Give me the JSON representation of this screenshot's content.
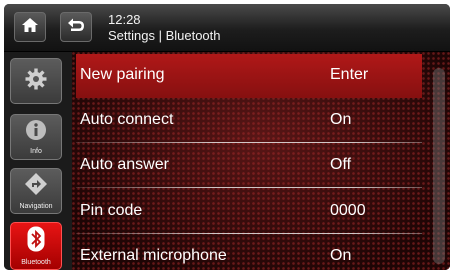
{
  "header": {
    "time": "12:28",
    "breadcrumb": "Settings | Bluetooth"
  },
  "sidebar": {
    "items": [
      {
        "label": "",
        "icon": "gear-icon"
      },
      {
        "label": "Info",
        "icon": "info-icon"
      },
      {
        "label": "Navigation",
        "icon": "navigation-icon"
      },
      {
        "label": "Bluetooth",
        "icon": "bluetooth-icon",
        "active": true
      }
    ]
  },
  "settings": {
    "rows": [
      {
        "name": "New pairing",
        "value": "Enter",
        "selected": true
      },
      {
        "name": "Auto connect",
        "value": "On"
      },
      {
        "name": "Auto answer",
        "value": "Off"
      },
      {
        "name": "Pin code",
        "value": "0000"
      },
      {
        "name": "External microphone",
        "value": "On"
      }
    ]
  },
  "colors": {
    "accent": "#c01010",
    "header": "#1d1d1d",
    "content_bg": "#3a0c0c"
  }
}
